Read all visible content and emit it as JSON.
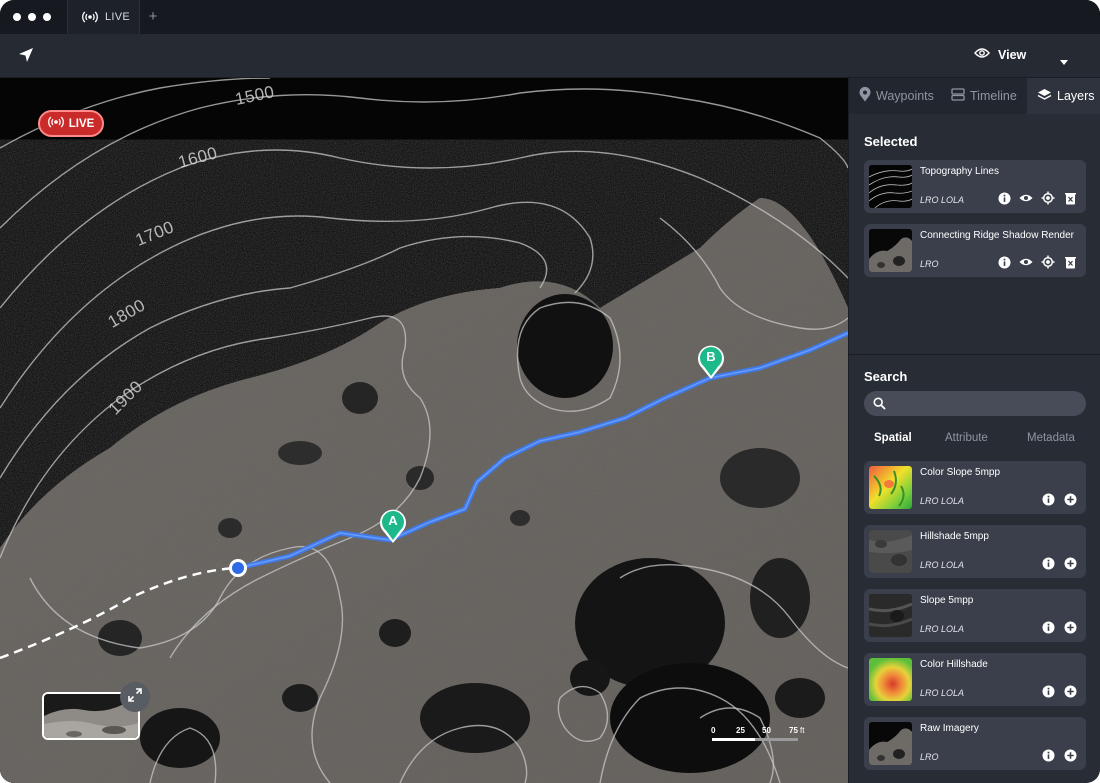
{
  "tabbar": {
    "tab_label": "LIVE",
    "add_label": "+"
  },
  "toolbar": {
    "view_label": "View"
  },
  "map": {
    "live_badge": "LIVE",
    "contours": [
      "1500",
      "1600",
      "1700",
      "1800",
      "1900"
    ],
    "waypoint_a": "A",
    "waypoint_b": "B",
    "scale": {
      "ticks": [
        "0",
        "25",
        "50",
        "75"
      ],
      "unit": "ft"
    }
  },
  "panel": {
    "tabs": [
      {
        "label": "Waypoints",
        "icon": "map-pin-icon"
      },
      {
        "label": "Timeline",
        "icon": "timeline-icon"
      },
      {
        "label": "Layers",
        "icon": "layers-icon"
      }
    ],
    "selected_title": "Selected",
    "selected": [
      {
        "name": "Topography Lines",
        "source": "LRO LOLA"
      },
      {
        "name": "Connecting Ridge Shadow Render",
        "source": "LRO"
      }
    ],
    "search_title": "Search",
    "search_placeholder": "",
    "search_tabs": [
      "Spatial",
      "Attribute",
      "Metadata"
    ],
    "results": [
      {
        "name": "Color Slope 5mpp",
        "source": "LRO LOLA"
      },
      {
        "name": "Hillshade 5mpp",
        "source": "LRO LOLA"
      },
      {
        "name": "Slope 5mpp",
        "source": "LRO LOLA"
      },
      {
        "name": "Color Hillshade",
        "source": "LRO LOLA"
      },
      {
        "name": "Raw Imagery",
        "source": "LRO"
      }
    ]
  },
  "colors": {
    "route": "#3d7bf0",
    "waypoint": "#1db98a",
    "live": "#c92a2a",
    "panel": "#282c35",
    "card": "#3a3f4b"
  }
}
